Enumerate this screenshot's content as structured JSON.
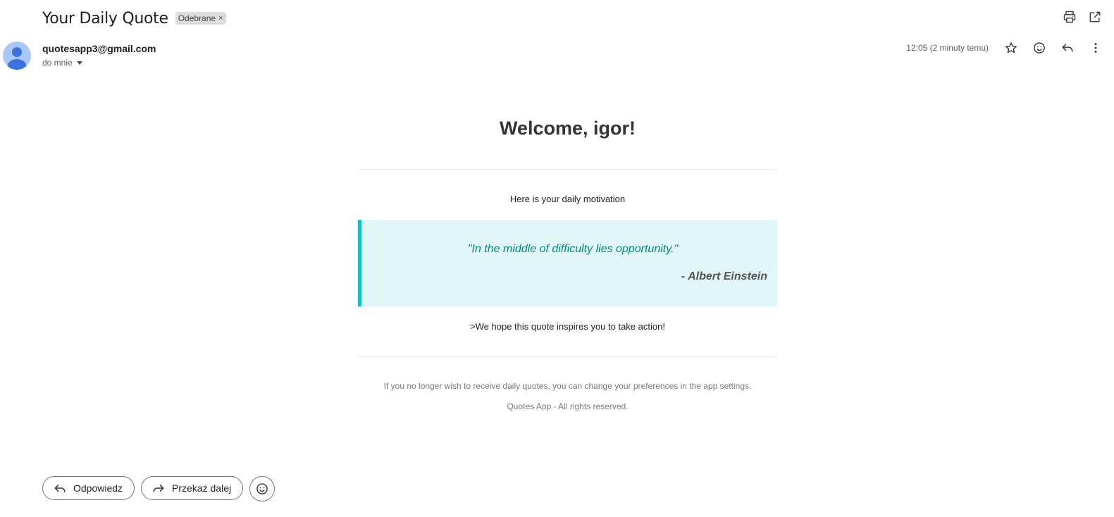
{
  "header": {
    "subject": "Your Daily Quote",
    "label_chip": "Odebrane",
    "label_chip_close": "×"
  },
  "message": {
    "sender": "quotesapp3@gmail.com",
    "recipient": "do mnie",
    "timestamp": "12:05 (2 minuty temu)"
  },
  "email": {
    "welcome": "Welcome, igor!",
    "intro": "Here is your daily motivation",
    "quote": "\"In the middle of difficulty lies opportunity.\"",
    "author": "- Albert Einstein",
    "closing": ">We hope this quote inspires you to take action!",
    "footer_prefs": "If you no longer wish to receive daily quotes, you can change your preferences in the app settings.",
    "footer_copyright": "Quotes App - All rights reserved."
  },
  "actions": {
    "reply": "Odpowiedz",
    "forward": "Przekaż dalej"
  },
  "colors": {
    "quote_accent": "#17becf",
    "quote_background": "#e0f6f7",
    "quote_text": "#00897b"
  }
}
